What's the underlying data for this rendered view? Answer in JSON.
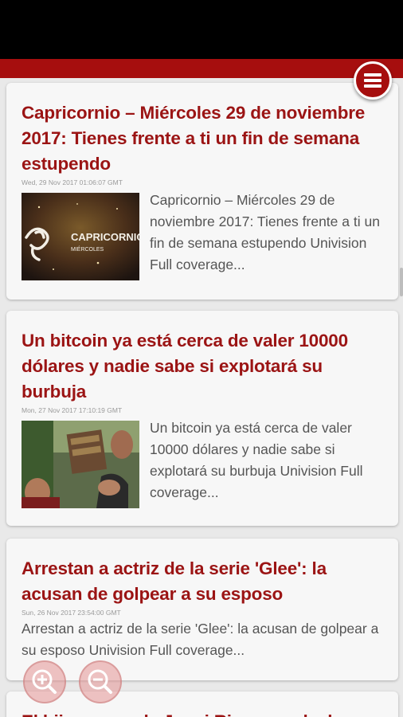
{
  "articles": [
    {
      "title": "Capricornio – Miércoles 29 de noviembre 2017: Tienes frente a ti un fin de semana estupendo",
      "date": "Wed, 29 Nov 2017 01:06:07 GMT",
      "snippet": "Capricornio – Miércoles 29 de noviembre 2017: Tienes frente a ti un fin de semana estupendo Univision  Full coverage...",
      "thumb_caption": "CAPRICORNIO",
      "thumb_subcaption": "MIÉRCOLES"
    },
    {
      "title": "Un bitcoin ya está cerca de valer 10000 dólares y nadie sabe si explotará su burbuja",
      "date": "Mon, 27 Nov 2017 17:10:19 GMT",
      "snippet": "Un bitcoin ya está cerca de valer 10000 dólares y nadie sabe si explotará su burbuja  Univision  Full coverage..."
    },
    {
      "title": "Arrestan a actriz de la serie 'Glee': la acusan de golpear a su esposo",
      "date": "Sun, 26 Nov 2017 23:54:00 GMT",
      "snippet": "Arrestan a actriz de la serie 'Glee': la acusan de golpear a su esposo  Univision  Full coverage..."
    },
    {
      "title": "El hijo menor de Jenni Rivera se declara"
    }
  ],
  "icons": {
    "menu": "hamburger-menu-icon",
    "zoom_in": "zoom-in-icon",
    "zoom_out": "zoom-out-icon"
  },
  "colors": {
    "accent": "#a60e0e",
    "title": "#9b1414",
    "snippet": "#555555",
    "date": "#9a9a9a",
    "card": "#f7f7f7",
    "background": "#e9e9e9"
  }
}
